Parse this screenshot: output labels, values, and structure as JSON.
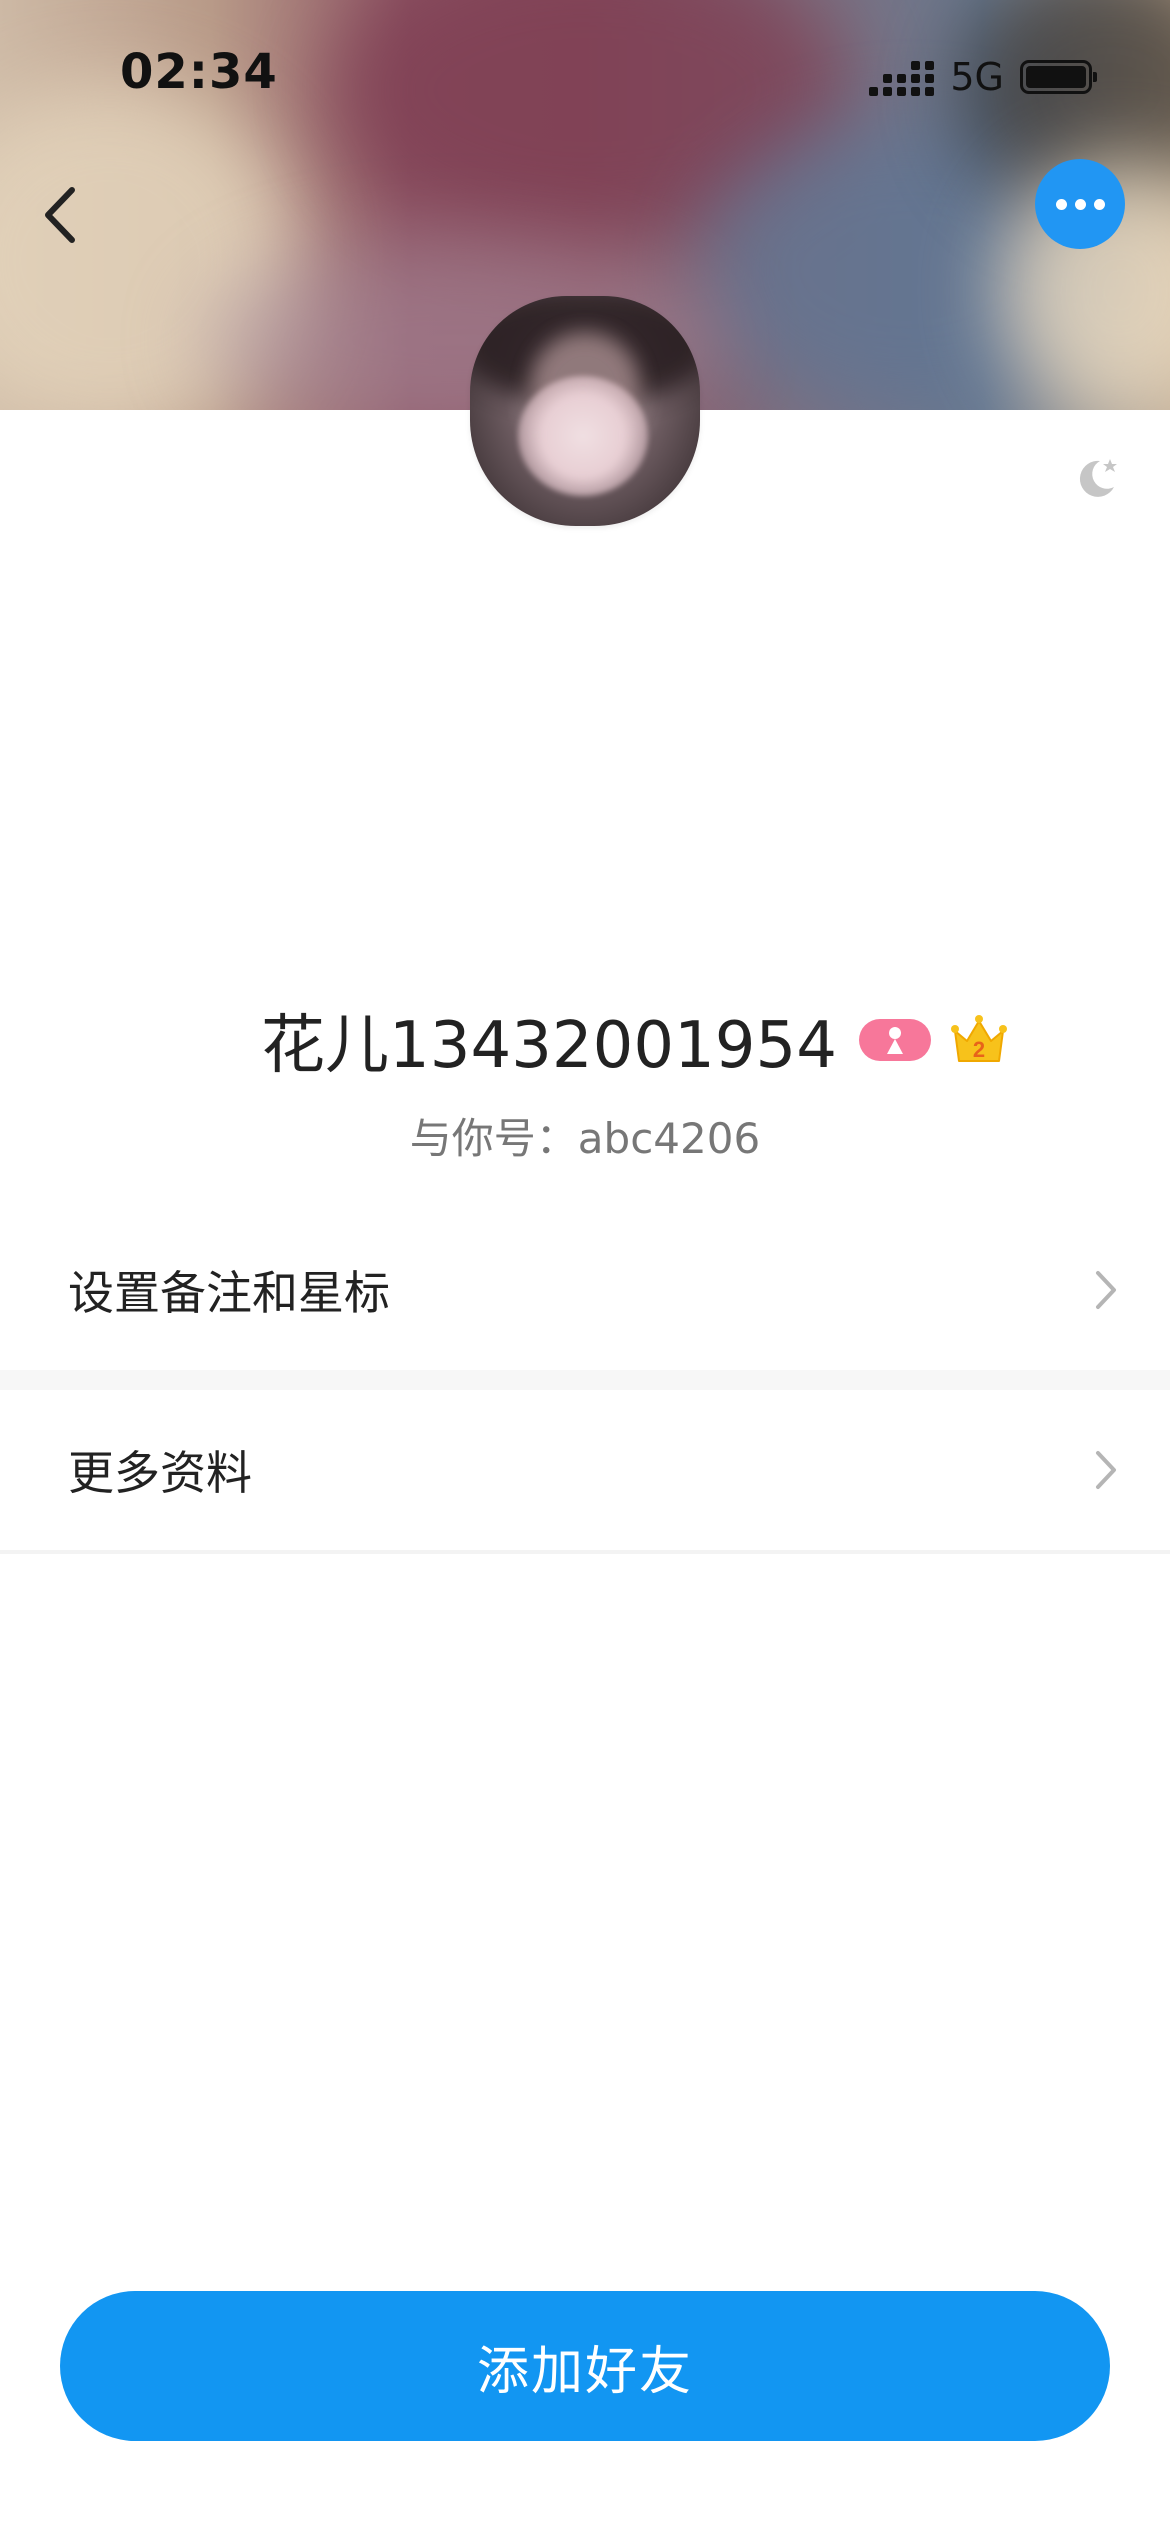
{
  "status_bar": {
    "time": "02:34",
    "network": "5G"
  },
  "profile": {
    "nickname": "花儿13432001954",
    "account_line": "与你号：abc4206",
    "crown_level": "2"
  },
  "menu": {
    "items": [
      {
        "label": "设置备注和星标"
      },
      {
        "label": "更多资料"
      }
    ]
  },
  "actions": {
    "add_friend_label": "添加好友"
  },
  "colors": {
    "accent": "#1296f2",
    "more_button": "#2196f3",
    "gender_badge": "#f7779a",
    "crown": "#f7c21b"
  },
  "icons": {
    "back": "chevron-left-icon",
    "more": "more-dots-icon",
    "theme": "moon-star-icon",
    "gender": "female-icon",
    "crown": "crown-icon",
    "chevron": "chevron-right-icon"
  }
}
